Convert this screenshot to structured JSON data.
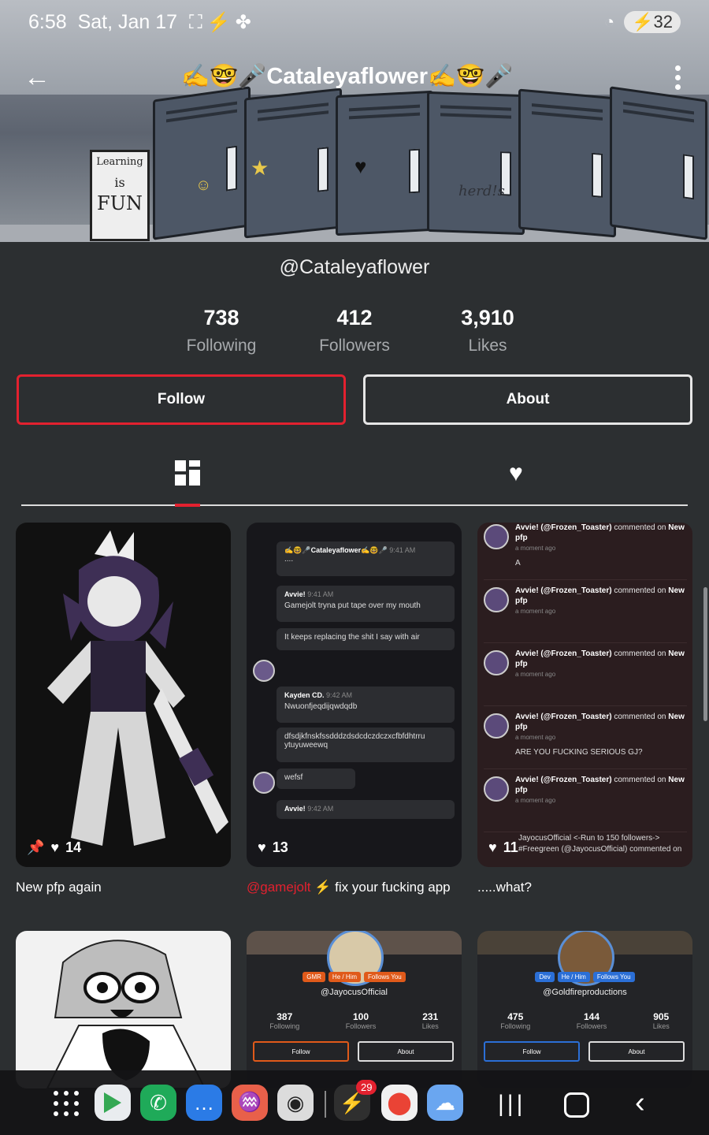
{
  "status_bar": {
    "time": "6:58",
    "date": "Sat, Jan 17",
    "battery": "32"
  },
  "header": {
    "title": "✍️🤓🎤Cataleyaflower✍️🤓🎤"
  },
  "banner": {
    "board_text": [
      "Learning",
      "is",
      "FUN"
    ],
    "doodle": "herd!s"
  },
  "profile": {
    "handle": "@Cataleyaflower",
    "stats": [
      {
        "value": "738",
        "label": "Following"
      },
      {
        "value": "412",
        "label": "Followers"
      },
      {
        "value": "3,910",
        "label": "Likes"
      }
    ],
    "follow_label": "Follow",
    "about_label": "About"
  },
  "tabs": {
    "active": "posts",
    "accent": "#e3212f"
  },
  "posts": [
    {
      "likes": "14",
      "caption": "New pfp again"
    },
    {
      "likes": "13",
      "caption_mention": "@gamejolt",
      "caption_text": "fix your fucking app",
      "chat": {
        "sender_1": "✍️🤓🎤Cataleyaflower✍️🤓🎤",
        "time_1": "9:41 AM",
        "msg_1": "....",
        "sender_2": "Avvie!",
        "time_2": "9:41 AM",
        "msg_2": "Gamejolt tryna put tape over my mouth",
        "msg_3": "It keeps replacing the shit I say with air",
        "sender_3": "Kayden CD.",
        "time_3": "9:42 AM",
        "msg_4": "Nwuonfjeqdijqwdqdb",
        "msg_5": "dfsdjkfnskfssdddzdsdcdczdczxcfbfdhtrru ytuyuweewq",
        "msg_6": "wefsf",
        "sender_4": "Avvie!",
        "time_4": "9:42 AM"
      }
    },
    {
      "likes": "11",
      "caption": ".....what?",
      "notifications": [
        {
          "who": "Avvie! (@Frozen_Toaster)",
          "action": "commented on",
          "target": "New pfp",
          "ago": "a moment ago",
          "reply": "A"
        },
        {
          "who": "Avvie! (@Frozen_Toaster)",
          "action": "commented on",
          "target": "New pfp",
          "ago": "a moment ago",
          "reply": ""
        },
        {
          "who": "Avvie! (@Frozen_Toaster)",
          "action": "commented on",
          "target": "New pfp",
          "ago": "a moment ago",
          "reply": ""
        },
        {
          "who": "Avvie! (@Frozen_Toaster)",
          "action": "commented on",
          "target": "New pfp",
          "ago": "a moment ago",
          "reply": "ARE YOU FUCKING SERIOUS GJ?"
        },
        {
          "who": "Avvie! (@Frozen_Toaster)",
          "action": "commented on",
          "target": "New pfp",
          "ago": "a moment ago",
          "reply": ""
        }
      ],
      "last_notification": "JayocusOfficial <-Run to 150 followers-> #Freegreen (@JayocusOfficial) commented on"
    }
  ],
  "mini_profiles": [
    {
      "tags": [
        "GMR",
        "He / Him",
        "Follows You"
      ],
      "name": "@JayocusOfficial",
      "stats": [
        {
          "value": "387",
          "label": "Following"
        },
        {
          "value": "100",
          "label": "Followers"
        },
        {
          "value": "231",
          "label": "Likes"
        }
      ],
      "follow_label": "Follow",
      "about_label": "About"
    },
    {
      "tags": [
        "Dev",
        "He / Him",
        "Follows You"
      ],
      "name": "@Goldfireproductions",
      "stats": [
        {
          "value": "475",
          "label": "Following"
        },
        {
          "value": "144",
          "label": "Followers"
        },
        {
          "value": "905",
          "label": "Likes"
        }
      ],
      "follow_label": "Follow",
      "about_label": "About"
    }
  ],
  "navbar": {
    "notification_badge": "29"
  }
}
